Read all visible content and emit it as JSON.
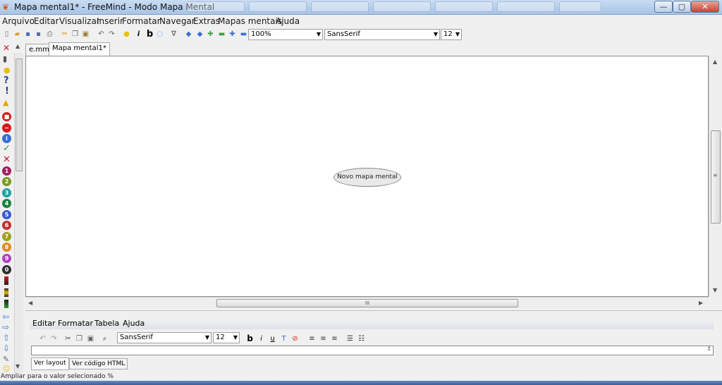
{
  "window": {
    "title": "Mapa mental1* - FreeMind - Modo Mapa Mental",
    "icon": "freemind-butterfly-icon",
    "buttons": {
      "minimize": "—",
      "maximize": "▢",
      "close": "✕"
    }
  },
  "menubar": {
    "items": [
      "Arquivo",
      "Editar",
      "Visualizar",
      "Inserir",
      "Formatar",
      "Navegar",
      "Extras",
      "Mapas mentais",
      "Ajuda"
    ]
  },
  "toolbar": {
    "zoom": "100%",
    "font": "SansSerif",
    "size": "12"
  },
  "tabs": [
    "e.mm",
    "Mapa mental1*"
  ],
  "map": {
    "root_node": "Novo mapa mental",
    "hscroll_grip": "III",
    "vscroll_grip": "≡"
  },
  "editor": {
    "menu": [
      "Editar",
      "Formatar",
      "Tabela",
      "Ajuda"
    ],
    "font": "SansSerif",
    "size": "12",
    "tabs": [
      "Ver layout",
      "Ver código HTML"
    ]
  },
  "status": "Ampliar para o valor selecionado %",
  "colors": {
    "titlebar": "#b5cdea",
    "canvas": "#ffffff",
    "node_fill": "#e8e8e8"
  }
}
